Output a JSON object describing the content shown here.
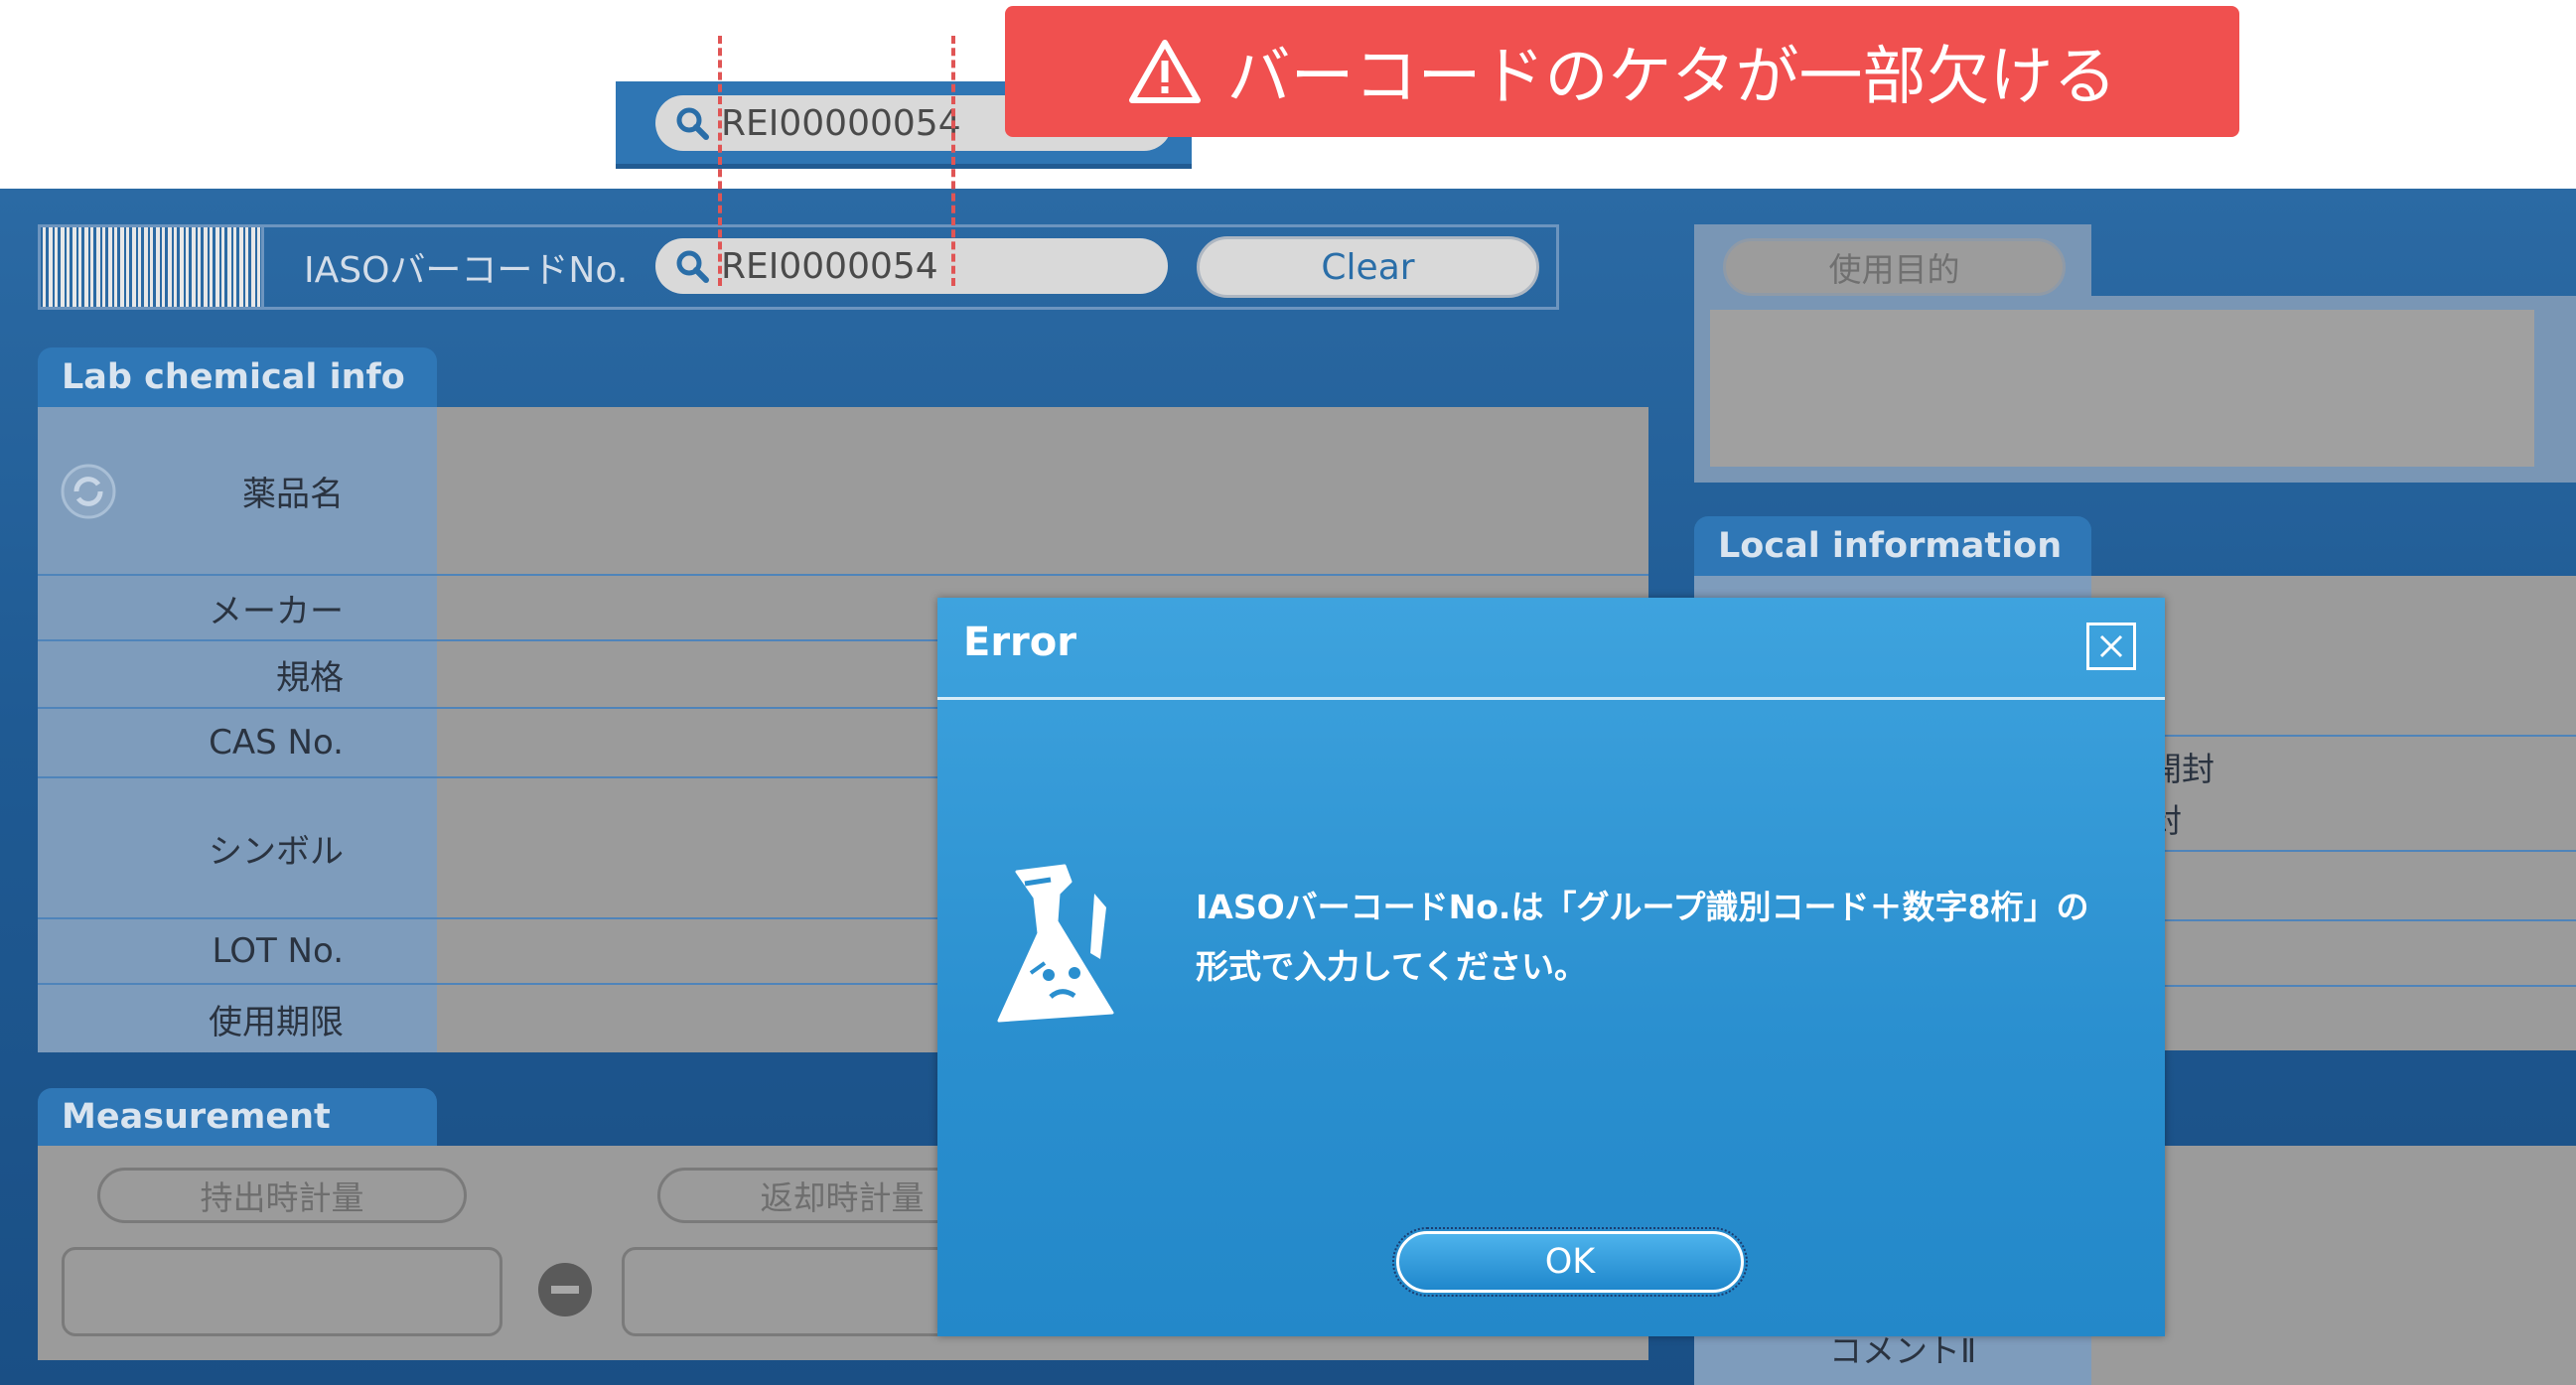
{
  "callout": {
    "zoomed_search_value": "REI00000054",
    "warning_text": "バーコードのケタが一部欠ける"
  },
  "header": {
    "barcode_label": "IASOバーコードNo.",
    "search_value": "REI0000054",
    "clear_label": "Clear"
  },
  "lab_info": {
    "tab_label": "Lab chemical info",
    "rows": [
      {
        "label": "薬品名"
      },
      {
        "label": "メーカー"
      },
      {
        "label": "規格"
      },
      {
        "label": "CAS No."
      },
      {
        "label": "シンボル"
      },
      {
        "label": "LOT No."
      },
      {
        "label": "使用期限"
      }
    ]
  },
  "measurement": {
    "tab_label": "Measurement",
    "take_out_label": "持出時計量",
    "return_label": "返却時計量"
  },
  "right_panel": {
    "purpose_label": "使用目的",
    "local_tab_label": "Local information",
    "partial_text_1": "開封",
    "partial_text_2": "封",
    "partial_comment": "コメントⅡ"
  },
  "dialog": {
    "title": "Error",
    "message_line1": "IASOバーコードNo.は「グループ識別コード＋数字8桁」の",
    "message_line2": "形式で入力してください。",
    "ok_label": "OK"
  }
}
